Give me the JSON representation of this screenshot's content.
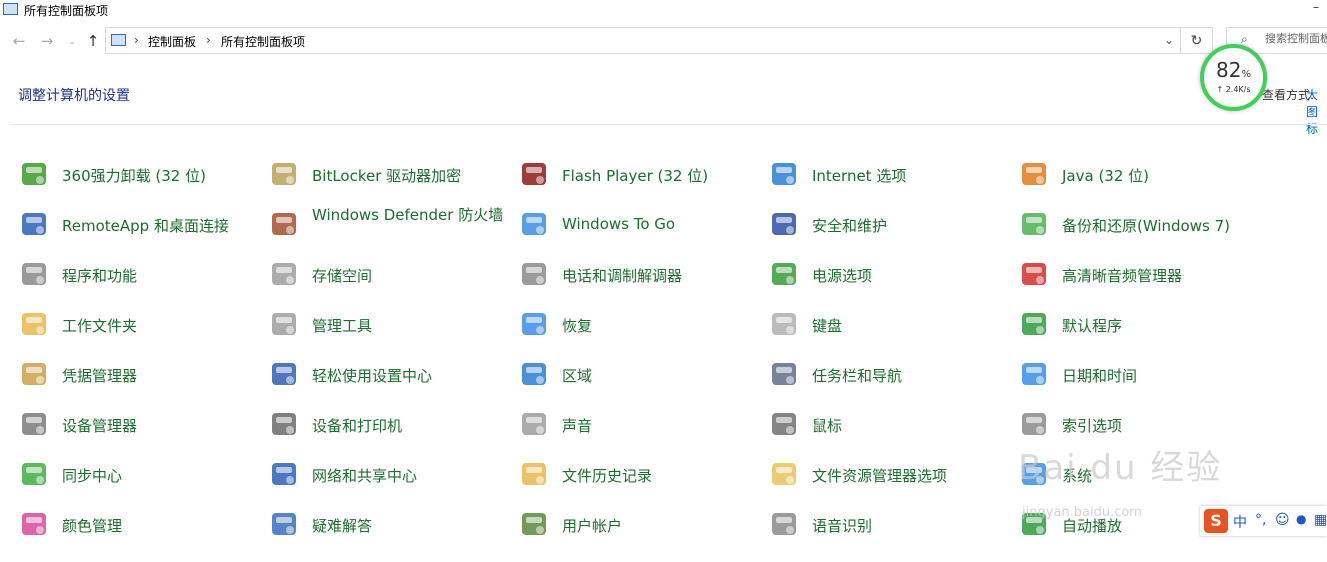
{
  "window": {
    "title": "所有控制面板项",
    "minimize_glyph": "–"
  },
  "nav": {
    "back": "←",
    "forward": "→",
    "recent": "⌄",
    "up": "↑",
    "refresh": "↻",
    "dropdown": "⌄"
  },
  "breadcrumbs": [
    "控制面板",
    "所有控制面板项"
  ],
  "search": {
    "placeholder": "搜索控制面板"
  },
  "heading": "调整计算机的设置",
  "view_by": {
    "label": "查看方式:",
    "value": "大图标"
  },
  "gauge": {
    "percent": "82",
    "unit": "%",
    "speed": "↑ 2.4K/s"
  },
  "items": [
    {
      "label": "360强力卸载 (32 位)",
      "icon": "uninstall-icon",
      "color": "#3c9a2a"
    },
    {
      "label": "BitLocker 驱动器加密",
      "icon": "bitlocker-icon",
      "color": "#b7a15a"
    },
    {
      "label": "Flash Player (32 位)",
      "icon": "flash-icon",
      "color": "#8b1a1a"
    },
    {
      "label": "Internet 选项",
      "icon": "internet-options-icon",
      "color": "#2a7fd0"
    },
    {
      "label": "Java (32 位)",
      "icon": "java-icon",
      "color": "#e07a1b"
    },
    {
      "label": "RemoteApp 和桌面连接",
      "icon": "remoteapp-icon",
      "color": "#2b5fb8"
    },
    {
      "label": "Windows Defender 防火墙",
      "icon": "firewall-icon",
      "color": "#a0522d"
    },
    {
      "label": "Windows To Go",
      "icon": "windows-to-go-icon",
      "color": "#3a8ee6"
    },
    {
      "label": "安全和维护",
      "icon": "flag-icon",
      "color": "#2d4fa3"
    },
    {
      "label": "备份和还原(Windows 7)",
      "icon": "backup-icon",
      "color": "#4caf50"
    },
    {
      "label": "程序和功能",
      "icon": "programs-icon",
      "color": "#888888"
    },
    {
      "label": "存储空间",
      "icon": "storage-icon",
      "color": "#9e9e9e"
    },
    {
      "label": "电话和调制解调器",
      "icon": "phone-icon",
      "color": "#8a8a8a"
    },
    {
      "label": "电源选项",
      "icon": "power-icon",
      "color": "#3a9b3a"
    },
    {
      "label": "高清晰音频管理器",
      "icon": "audio-manager-icon",
      "color": "#d22d2d"
    },
    {
      "label": "工作文件夹",
      "icon": "work-folders-icon",
      "color": "#e8b84a"
    },
    {
      "label": "管理工具",
      "icon": "admin-tools-icon",
      "color": "#9e9e9e"
    },
    {
      "label": "恢复",
      "icon": "recovery-icon",
      "color": "#3a8ee6"
    },
    {
      "label": "键盘",
      "icon": "keyboard-icon",
      "color": "#b0b0b0"
    },
    {
      "label": "默认程序",
      "icon": "default-programs-icon",
      "color": "#2e9b3e"
    },
    {
      "label": "凭据管理器",
      "icon": "credential-icon",
      "color": "#c9a24a"
    },
    {
      "label": "轻松使用设置中心",
      "icon": "ease-of-access-icon",
      "color": "#2f5fb3"
    },
    {
      "label": "区域",
      "icon": "region-icon",
      "color": "#2a7fd0"
    },
    {
      "label": "任务栏和导航",
      "icon": "taskbar-icon",
      "color": "#5a6f8a"
    },
    {
      "label": "日期和时间",
      "icon": "calendar-icon",
      "color": "#3a8ee6"
    },
    {
      "label": "设备管理器",
      "icon": "device-manager-icon",
      "color": "#7a7a7a"
    },
    {
      "label": "设备和打印机",
      "icon": "printer-icon",
      "color": "#6a6a6a"
    },
    {
      "label": "声音",
      "icon": "speaker-icon",
      "color": "#9e9e9e"
    },
    {
      "label": "鼠标",
      "icon": "mouse-icon",
      "color": "#707070"
    },
    {
      "label": "索引选项",
      "icon": "indexing-icon",
      "color": "#8a8a8a"
    },
    {
      "label": "同步中心",
      "icon": "sync-icon",
      "color": "#3fae3f"
    },
    {
      "label": "网络和共享中心",
      "icon": "network-icon",
      "color": "#2b5fb8"
    },
    {
      "label": "文件历史记录",
      "icon": "file-history-icon",
      "color": "#e8b84a"
    },
    {
      "label": "文件资源管理器选项",
      "icon": "folder-options-icon",
      "color": "#e8c35a"
    },
    {
      "label": "系统",
      "icon": "system-icon",
      "color": "#3a8ee6"
    },
    {
      "label": "颜色管理",
      "icon": "color-management-icon",
      "color": "#d64a9a"
    },
    {
      "label": "疑难解答",
      "icon": "troubleshoot-icon",
      "color": "#3a6fc0"
    },
    {
      "label": "用户帐户",
      "icon": "user-accounts-icon",
      "color": "#5a8a3a"
    },
    {
      "label": "语音识别",
      "icon": "microphone-icon",
      "color": "#8a8a8a"
    },
    {
      "label": "自动播放",
      "icon": "autoplay-icon",
      "color": "#2e9b3e"
    }
  ],
  "watermark": {
    "main": "Bai du 经验",
    "sub": "jingyan.baidu.com"
  },
  "ime": {
    "logo": "S",
    "mode": "中",
    "punct": "°,",
    "emoji": "☺",
    "voice": "🎤",
    "more": "▦"
  }
}
